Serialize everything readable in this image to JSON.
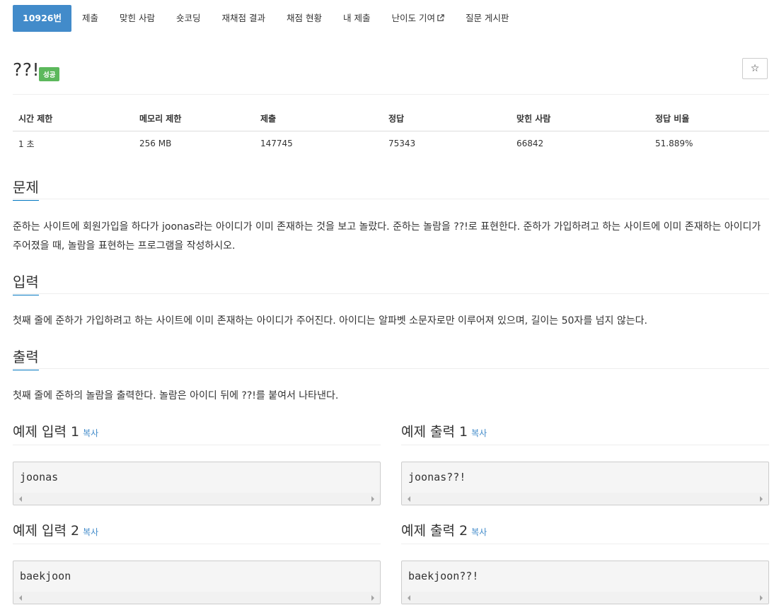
{
  "tabs": [
    {
      "label": "10926번",
      "active": true
    },
    {
      "label": "제출"
    },
    {
      "label": "맞힌 사람"
    },
    {
      "label": "숏코딩"
    },
    {
      "label": "재채점 결과"
    },
    {
      "label": "채점 현황"
    },
    {
      "label": "내 제출"
    },
    {
      "label": "난이도 기여",
      "icon": "external-link-icon"
    },
    {
      "label": "질문 게시판"
    }
  ],
  "problem": {
    "title": "??!",
    "badge": "성공",
    "star_icon": "☆"
  },
  "stats": {
    "headers": [
      "시간 제한",
      "메모리 제한",
      "제출",
      "정답",
      "맞힌 사람",
      "정답 비율"
    ],
    "values": [
      "1 초",
      "256 MB",
      "147745",
      "75343",
      "66842",
      "51.889%"
    ]
  },
  "sections": {
    "problem": {
      "title": "문제",
      "text": "준하는 사이트에 회원가입을 하다가 joonas라는 아이디가 이미 존재하는 것을 보고 놀랐다. 준하는 놀람을 ??!로 표현한다. 준하가 가입하려고 하는 사이트에 이미 존재하는 아이디가 주어졌을 때, 놀람을 표현하는 프로그램을 작성하시오."
    },
    "input": {
      "title": "입력",
      "text": "첫째 줄에 준하가 가입하려고 하는 사이트에 이미 존재하는 아이디가 주어진다. 아이디는 알파벳 소문자로만 이루어져 있으며, 길이는 50자를 넘지 않는다."
    },
    "output": {
      "title": "출력",
      "text": "첫째 줄에 준하의 놀람을 출력한다. 놀람은 아이디 뒤에 ??!를 붙여서 나타낸다."
    }
  },
  "samples": {
    "copy_label": "복사",
    "input1": {
      "title": "예제 입력 1",
      "content": "joonas"
    },
    "output1": {
      "title": "예제 출력 1",
      "content": "joonas??!"
    },
    "input2": {
      "title": "예제 입력 2",
      "content": "baekjoon"
    },
    "output2": {
      "title": "예제 출력 2",
      "content": "baekjoon??!"
    }
  },
  "colors": {
    "active_tab": "#428bca",
    "badge_success": "#5cb85c",
    "section_underline": "#0076c0",
    "link": "#428bca"
  }
}
